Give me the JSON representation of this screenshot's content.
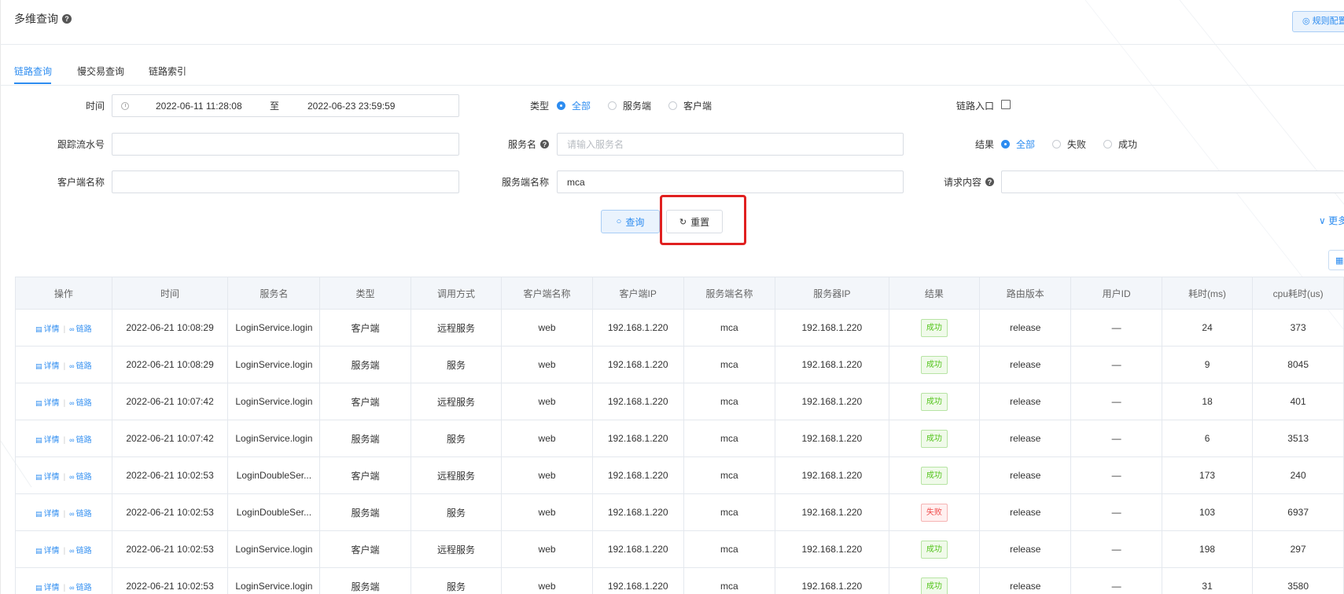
{
  "header": {
    "title": "多维查询",
    "rule_button": "◎ 规则配置"
  },
  "tabs": [
    {
      "label": "链路查询",
      "active": true
    },
    {
      "label": "慢交易查询"
    },
    {
      "label": "链路索引"
    }
  ],
  "form": {
    "time": {
      "label": "时间",
      "start": "2022-06-11 11:28:08",
      "separator": "至",
      "end": "2022-06-23 23:59:59"
    },
    "type": {
      "label": "类型",
      "options": [
        "全部",
        "服务端",
        "客户端"
      ],
      "selected": "全部"
    },
    "entry": {
      "label": "链路入口"
    },
    "trace_id": {
      "label": "跟踪流水号",
      "value": ""
    },
    "service_name": {
      "label": "服务名",
      "placeholder": "请输入服务名"
    },
    "result": {
      "label": "结果",
      "options": [
        "全部",
        "失败",
        "成功"
      ],
      "selected": "全部"
    },
    "client_name": {
      "label": "客户端名称",
      "value": ""
    },
    "server_name": {
      "label": "服务端名称",
      "value": "mca"
    },
    "request_content": {
      "label": "请求内容",
      "value": ""
    },
    "query_button": "查询",
    "reset_button": "重置",
    "more_link": "更多"
  },
  "colors": {
    "accent": "#2d8cf0",
    "success": "#52c41a",
    "fail": "#f04b4b",
    "highlight": "#e02020"
  },
  "table": {
    "columns": [
      "操作",
      "时间",
      "服务名",
      "类型",
      "调用方式",
      "客户端名称",
      "客户端IP",
      "服务端名称",
      "服务器IP",
      "结果",
      "路由版本",
      "用户ID",
      "耗时(ms)",
      "cpu耗时(us)"
    ],
    "op_detail": "详情",
    "op_trace": "链路",
    "rows": [
      [
        "2022-06-21 10:08:29",
        "LoginService.login",
        "客户端",
        "远程服务",
        "web",
        "192.168.1.220",
        "mca",
        "192.168.1.220",
        "成功",
        "release",
        "—",
        "24",
        "373"
      ],
      [
        "2022-06-21 10:08:29",
        "LoginService.login",
        "服务端",
        "服务",
        "web",
        "192.168.1.220",
        "mca",
        "192.168.1.220",
        "成功",
        "release",
        "—",
        "9",
        "8045"
      ],
      [
        "2022-06-21 10:07:42",
        "LoginService.login",
        "客户端",
        "远程服务",
        "web",
        "192.168.1.220",
        "mca",
        "192.168.1.220",
        "成功",
        "release",
        "—",
        "18",
        "401"
      ],
      [
        "2022-06-21 10:07:42",
        "LoginService.login",
        "服务端",
        "服务",
        "web",
        "192.168.1.220",
        "mca",
        "192.168.1.220",
        "成功",
        "release",
        "—",
        "6",
        "3513"
      ],
      [
        "2022-06-21 10:02:53",
        "LoginDoubleSer...",
        "客户端",
        "远程服务",
        "web",
        "192.168.1.220",
        "mca",
        "192.168.1.220",
        "成功",
        "release",
        "—",
        "173",
        "240"
      ],
      [
        "2022-06-21 10:02:53",
        "LoginDoubleSer...",
        "服务端",
        "服务",
        "web",
        "192.168.1.220",
        "mca",
        "192.168.1.220",
        "失败",
        "release",
        "—",
        "103",
        "6937"
      ],
      [
        "2022-06-21 10:02:53",
        "LoginService.login",
        "客户端",
        "远程服务",
        "web",
        "192.168.1.220",
        "mca",
        "192.168.1.220",
        "成功",
        "release",
        "—",
        "198",
        "297"
      ],
      [
        "2022-06-21 10:02:53",
        "LoginService.login",
        "服务端",
        "服务",
        "web",
        "192.168.1.220",
        "mca",
        "192.168.1.220",
        "成功",
        "release",
        "—",
        "31",
        "3580"
      ]
    ]
  }
}
